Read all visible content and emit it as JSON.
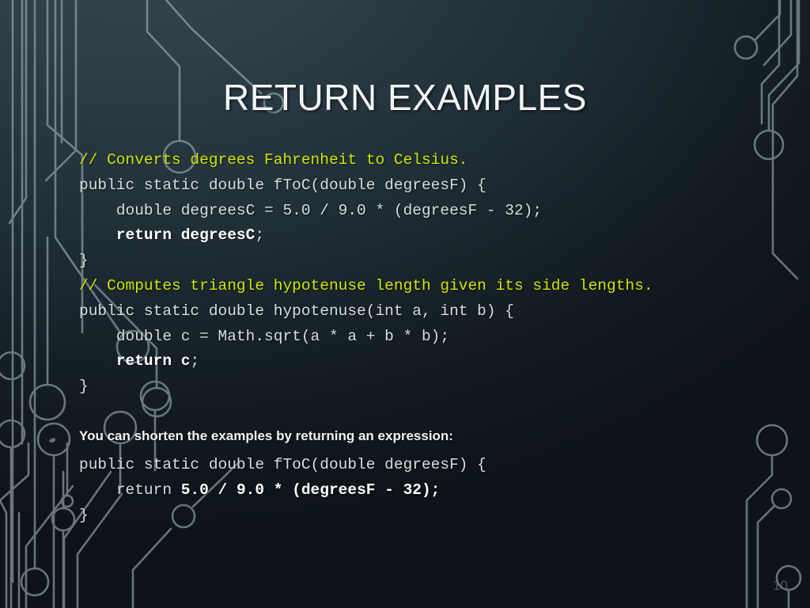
{
  "slide": {
    "title": "RETURN EXAMPLES",
    "page_number": "10",
    "colors": {
      "background_top": "#2e3f47",
      "background_bottom": "#0d1318",
      "comment_green": "#d2e300",
      "code_text": "#d6dee1",
      "bold_text": "#ffffff",
      "circuit_line": "#9fb0b7",
      "title_text": "#f2f6f7"
    }
  },
  "code_block_1": {
    "lines": [
      {
        "id": "l1",
        "indent": 0,
        "segments": [
          {
            "text": "// Converts degrees Fahrenheit to Celsius.",
            "style": "comment"
          }
        ]
      },
      {
        "id": "l2",
        "indent": 0,
        "segments": [
          {
            "text": "public static double fToC(double degreesF) {",
            "style": "normal"
          }
        ]
      },
      {
        "id": "l3",
        "indent": 1,
        "segments": [
          {
            "text": "double degreesC = 5.0 / 9.0 * (degreesF - 32);",
            "style": "normal"
          }
        ]
      },
      {
        "id": "l4",
        "indent": 1,
        "segments": [
          {
            "text": "return degreesC",
            "style": "bold"
          },
          {
            "text": ";",
            "style": "normal"
          }
        ]
      },
      {
        "id": "l5",
        "indent": 0,
        "segments": [
          {
            "text": "}",
            "style": "normal"
          }
        ]
      },
      {
        "id": "l6",
        "indent": 0,
        "segments": [
          {
            "text": "// Computes triangle hypotenuse length given its side lengths.",
            "style": "comment"
          }
        ]
      },
      {
        "id": "l7",
        "indent": 0,
        "segments": [
          {
            "text": "public static double hypotenuse(int a, int b) {",
            "style": "normal"
          }
        ]
      },
      {
        "id": "l8",
        "indent": 1,
        "segments": [
          {
            "text": "double c = Math.sqrt(a * a + b * b);",
            "style": "normal"
          }
        ]
      },
      {
        "id": "l9",
        "indent": 1,
        "segments": [
          {
            "text": "return c",
            "style": "bold"
          },
          {
            "text": ";",
            "style": "normal"
          }
        ]
      },
      {
        "id": "l10",
        "indent": 0,
        "segments": [
          {
            "text": "}",
            "style": "normal"
          }
        ]
      }
    ]
  },
  "prose": {
    "text": "You can shorten the examples by returning an expression:"
  },
  "code_block_2": {
    "lines": [
      {
        "id": "m1",
        "indent": 0,
        "segments": [
          {
            "text": "public static double fToC(double degreesF) {",
            "style": "normal"
          }
        ]
      },
      {
        "id": "m2",
        "indent": 1,
        "segments": [
          {
            "text": "return ",
            "style": "normal"
          },
          {
            "text": "5.0 / 9.0 * (degreesF - 32);",
            "style": "bold"
          }
        ]
      },
      {
        "id": "m3",
        "indent": 0,
        "segments": [
          {
            "text": "}",
            "style": "normal"
          }
        ]
      }
    ]
  },
  "decorations": {
    "circuit_top_left": "circuit-traces-top-left",
    "circuit_top_right": "circuit-traces-top-right",
    "circuit_bottom_left": "circuit-traces-bottom-left",
    "circuit_bottom_right": "circuit-traces-bottom-right"
  }
}
